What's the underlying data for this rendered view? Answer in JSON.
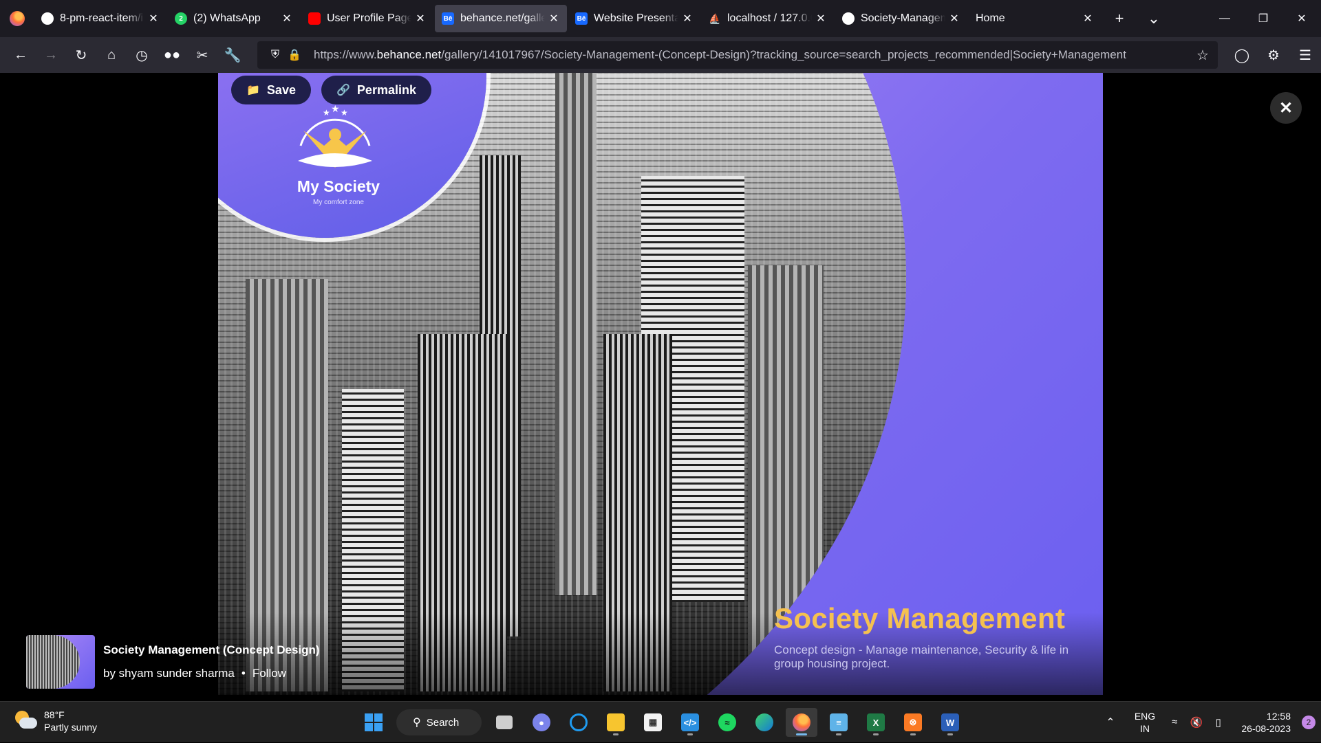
{
  "browser": {
    "tabs": [
      {
        "label": "8-pm-react-item/i",
        "favicon": "github-icon",
        "active": false
      },
      {
        "label": "(2) WhatsApp",
        "favicon": "whatsapp-icon",
        "badge": "2",
        "active": false
      },
      {
        "label": "User Profile Page",
        "favicon": "youtube-icon",
        "active": false
      },
      {
        "label": "behance.net/galle",
        "favicon": "behance-icon",
        "favicon_text": "Bē",
        "active": true
      },
      {
        "label": "Website Presentati",
        "favicon": "behance-icon",
        "favicon_text": "Bē",
        "active": false
      },
      {
        "label": "localhost / 127.0.0",
        "favicon": "phpmyadmin-icon",
        "active": false
      },
      {
        "label": "Society-Managem",
        "favicon": "github-icon",
        "active": false
      },
      {
        "label": "Home",
        "favicon": "",
        "active": false
      }
    ],
    "url_prefix": "https://www.",
    "url_domain": "behance.net",
    "url_rest": "/gallery/141017967/Society-Management-(Concept-Design)?tracking_source=search_projects_recommended|Society+Management"
  },
  "project": {
    "save_label": "Save",
    "permalink_label": "Permalink",
    "logo_title": "My Society",
    "logo_subtitle": "My comfort zone",
    "headline": "Society Management",
    "subheadline": "Concept design - Manage maintenance, Security & life in group housing project.",
    "title": "Society Management (Concept Design)",
    "author": "by shyam sunder sharma",
    "follow_label": "Follow"
  },
  "taskbar": {
    "weather_temp": "88°F",
    "weather_desc": "Partly sunny",
    "search_label": "Search",
    "lang_1": "ENG",
    "lang_2": "IN",
    "time": "12:58",
    "date": "26-08-2023",
    "notification_count": "2"
  },
  "colors": {
    "accent_purple": "#7e6bf0",
    "headline_gold": "#f5c150",
    "behance_blue": "#1769ff"
  }
}
